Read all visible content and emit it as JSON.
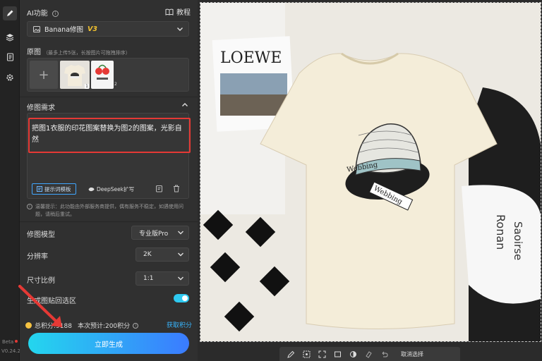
{
  "header": {
    "title": "AI功能",
    "tutorial_label": "教程"
  },
  "model_select": {
    "name": "Banana修图",
    "version": "V3"
  },
  "source": {
    "title": "原图",
    "hint": "（最多上传5张，长按图片可拖拽排序）",
    "thumb_numbers": [
      "1",
      "2"
    ]
  },
  "edit": {
    "title": "修图需求",
    "prompt": "把图1衣服的印花图案替换为图2的图案，光影自然",
    "template_btn": "提示词模板",
    "deepseek_btn": "DeepSeek扩写",
    "notice": "温馨提示：此功能由外部服务商提供，偶有服务不稳定，如遇使用问题，请稍后重试。"
  },
  "settings": {
    "model_label": "修图模型",
    "model_value": "专业版Pro",
    "resolution_label": "分辨率",
    "resolution_value": "2K",
    "ratio_label": "尺寸比例",
    "ratio_value": "1:1",
    "paste_label": "生成图贴回选区",
    "paste_on": true
  },
  "credits": {
    "total_text": "总积分:9188",
    "estimate_text": "本次预计:200积分",
    "get_link": "获取积分"
  },
  "generate_label": "立即生成",
  "app": {
    "beta": "Beta",
    "version": "V0.24.2"
  },
  "toolbar": {
    "cancel_label": "取消选择"
  },
  "photo_text": {
    "magazine_logo": "LOEWE",
    "hat_text_1": "Webbing",
    "hat_text_2": "Webbing",
    "shirt_text_1": "Ronan",
    "shirt_text_2": "Saoirse"
  },
  "colors": {
    "accent": "#2ec9f0",
    "highlight_border": "#e53935",
    "credits_link": "#38b6ff",
    "coin": "#f5c242"
  }
}
